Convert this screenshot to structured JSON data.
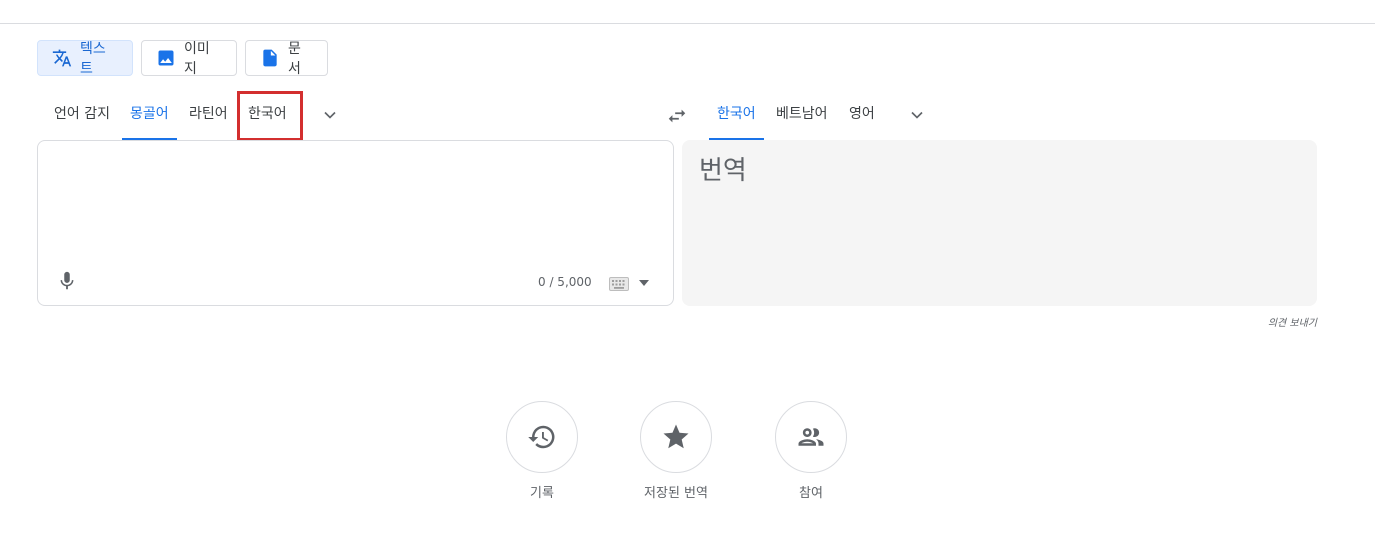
{
  "mode_buttons": {
    "text": "텍스트",
    "image": "이미지",
    "document": "문서"
  },
  "source_languages": [
    "언어 감지",
    "몽골어",
    "라틴어",
    "한국어"
  ],
  "target_languages": [
    "한국어",
    "베트남어",
    "영어"
  ],
  "source": {
    "value": "",
    "char_count": "0 / 5,000"
  },
  "target": {
    "placeholder_text": "번역"
  },
  "feedback_link": "의견 보내기",
  "bottom_actions": {
    "history": "기록",
    "saved": "저장된 번역",
    "contribute": "참여"
  },
  "colors": {
    "accent": "#1a73e8",
    "highlight_box": "#d32f2f"
  },
  "icons": {
    "text_mode": "translate-icon",
    "image_mode": "image-icon",
    "doc_mode": "document-icon",
    "swap": "swap-icon",
    "more": "chevron-down-icon",
    "mic": "microphone-icon",
    "keyboard": "keyboard-icon",
    "history": "history-icon",
    "saved": "star-icon",
    "contribute": "people-icon"
  }
}
